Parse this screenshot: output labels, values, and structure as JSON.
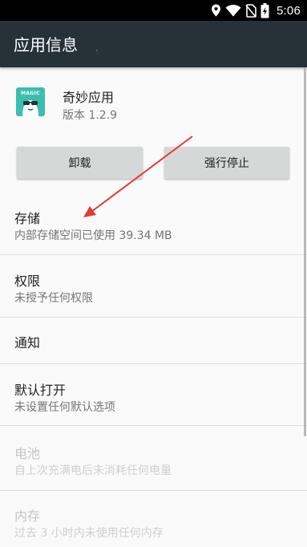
{
  "status_bar": {
    "time": "5:06",
    "icons": [
      "location-icon",
      "wifi-icon",
      "no-sim-icon",
      "battery-charging-icon"
    ]
  },
  "app_bar": {
    "title": "应用信息"
  },
  "app": {
    "name": "奇妙应用",
    "version": "版本 1.2.9",
    "icon_label": "MAGIC",
    "icon_color": "#3bbfad"
  },
  "buttons": {
    "uninstall": "卸载",
    "force_stop": "强行停止"
  },
  "items": [
    {
      "title": "存储",
      "subtitle": "内部存储空间已使用 39.34 MB",
      "enabled": true
    },
    {
      "title": "权限",
      "subtitle": "未授予任何权限",
      "enabled": true
    },
    {
      "title": "通知",
      "enabled": true
    },
    {
      "title": "默认打开",
      "subtitle": "未设置任何默认选项",
      "enabled": true
    },
    {
      "title": "电池",
      "subtitle": "自上次充满电后未消耗任何电量",
      "enabled": false
    },
    {
      "title": "内存",
      "subtitle": "过去 3 小时内未使用任何内存",
      "enabled": false
    }
  ],
  "colors": {
    "app_bar": "#263238",
    "status_bar": "#000000",
    "annotation_arrow": "#e53935"
  }
}
